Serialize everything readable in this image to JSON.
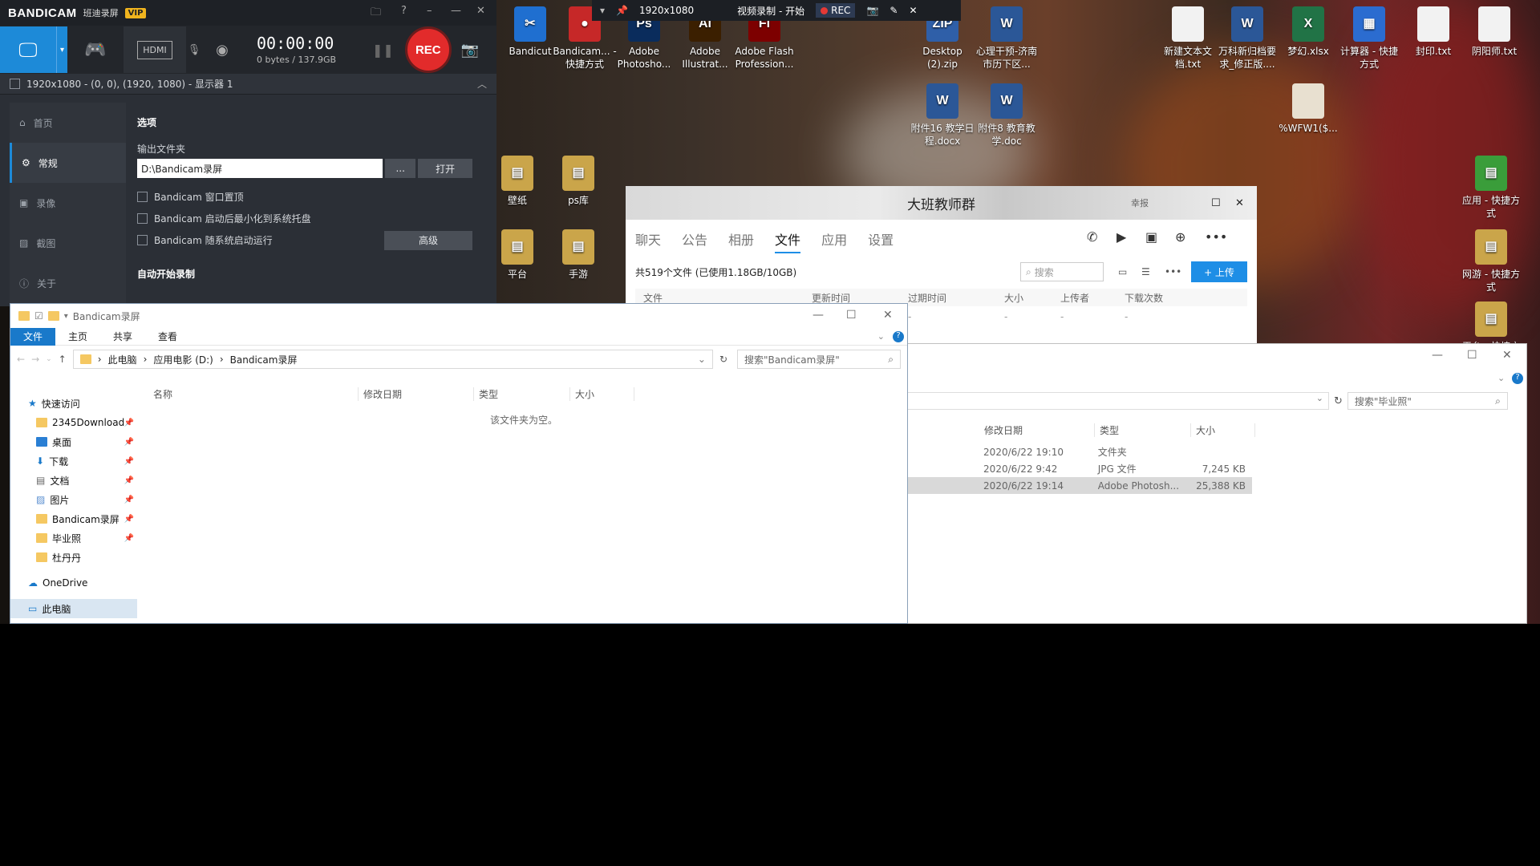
{
  "topbar": {
    "resolution": "1920x1080",
    "title": "视频录制 - 开始",
    "rec": "REC"
  },
  "desktop": {
    "icons": [
      {
        "label": "Bandicut",
        "color": "#1f6fd0",
        "glyph": "✂"
      },
      {
        "label": "Bandicam... - 快捷方式",
        "color": "#c62828",
        "glyph": "●"
      },
      {
        "label": "Adobe Photosho...",
        "color": "#0a2c5c",
        "glyph": "Ps"
      },
      {
        "label": "Adobe Illustrat...",
        "color": "#3b1f00",
        "glyph": "Ai"
      },
      {
        "label": "Adobe Flash Profession...",
        "color": "#7d0000",
        "glyph": "Fl"
      },
      {
        "label": "Desktop (2).zip",
        "color": "#2f5fa8",
        "glyph": "ZIP"
      },
      {
        "label": "心理干预-济南市历下区...",
        "color": "#2b5797",
        "glyph": "W"
      },
      {
        "label": "新建文本文档.txt",
        "color": "#f2f2f2",
        "glyph": ""
      },
      {
        "label": "万科新归档要求_修正版....",
        "color": "#2b5797",
        "glyph": "W"
      },
      {
        "label": "梦幻.xlsx",
        "color": "#217346",
        "glyph": "X"
      },
      {
        "label": "计算器 - 快捷方式",
        "color": "#2b6cd0",
        "glyph": "▦"
      },
      {
        "label": "封印.txt",
        "color": "#f2f2f2",
        "glyph": ""
      },
      {
        "label": "阴阳师.txt",
        "color": "#f2f2f2",
        "glyph": ""
      },
      {
        "label": "附件16 教学日程.docx",
        "color": "#2b5797",
        "glyph": "W"
      },
      {
        "label": "附件8 教育教学.doc",
        "color": "#2b5797",
        "glyph": "W"
      },
      {
        "label": "%WFW1($...",
        "color": "#e8e0d0",
        "glyph": ""
      },
      {
        "label": "壁纸",
        "color": "#caa54a",
        "glyph": "▤"
      },
      {
        "label": "ps库",
        "color": "#caa54a",
        "glyph": "▤"
      },
      {
        "label": "平台",
        "color": "#caa54a",
        "glyph": "▤"
      },
      {
        "label": "手游",
        "color": "#caa54a",
        "glyph": "▤"
      },
      {
        "label": "应用 - 快捷方式",
        "color": "#3a9d3a",
        "glyph": "▤"
      },
      {
        "label": "网游 - 快捷方式",
        "color": "#caa54a",
        "glyph": "▤"
      },
      {
        "label": "平台 - 快捷方式",
        "color": "#caa54a",
        "glyph": "▤"
      }
    ]
  },
  "bandicam": {
    "logo": "BANDICAM",
    "cn": "班迪录屏",
    "vip": "VIP",
    "timer": "00:00:00",
    "size": "0 bytes / 137.9GB",
    "rec": "REC",
    "target": "1920x1080 - (0, 0), (1920, 1080) - 显示器 1",
    "side": [
      "首页",
      "常规",
      "录像",
      "截图",
      "关于"
    ],
    "section": "选项",
    "folder_label": "输出文件夹",
    "folder": "D:\\Bandicam录屏",
    "browse": "...",
    "open": "打开",
    "checks": [
      "Bandicam 窗口置顶",
      "Bandicam 启动后最小化到系统托盘",
      "Bandicam 随系统启动运行"
    ],
    "advanced": "高级",
    "autostart": "自动开始录制"
  },
  "qq": {
    "title": "大班教师群",
    "tag": "幸报",
    "tabs": [
      "聊天",
      "公告",
      "相册",
      "文件",
      "应用",
      "设置"
    ],
    "summary": "共519个文件 (已使用1.18GB/10GB)",
    "search": "搜索",
    "upload": "+ 上传",
    "cols": [
      "文件",
      "更新时间",
      "过期时间",
      "大小",
      "上传者",
      "下载次数"
    ]
  },
  "explorer1": {
    "title": "Bandicam录屏",
    "ribbon": [
      "文件",
      "主页",
      "共享",
      "查看"
    ],
    "crumbs": [
      "此电脑",
      "应用电影 (D:)",
      "Bandicam录屏"
    ],
    "search": "搜索\"Bandicam录屏\"",
    "cols": [
      "名称",
      "修改日期",
      "类型",
      "大小"
    ],
    "empty": "该文件夹为空。",
    "nav": [
      "快速访问",
      "2345Download",
      "桌面",
      "下载",
      "文档",
      "图片",
      "Bandicam录屏",
      "毕业照",
      "杜丹丹",
      "OneDrive",
      "此电脑"
    ]
  },
  "explorer2": {
    "search": "搜索\"毕业照\"",
    "cols": [
      "修改日期",
      "类型",
      "大小"
    ],
    "rows": [
      [
        "2020/6/22 19:10",
        "文件夹",
        ""
      ],
      [
        "2020/6/22 9:42",
        "JPG 文件",
        "7,245 KB"
      ],
      [
        "2020/6/22 19:14",
        "Adobe Photosh...",
        "25,388 KB"
      ]
    ]
  }
}
